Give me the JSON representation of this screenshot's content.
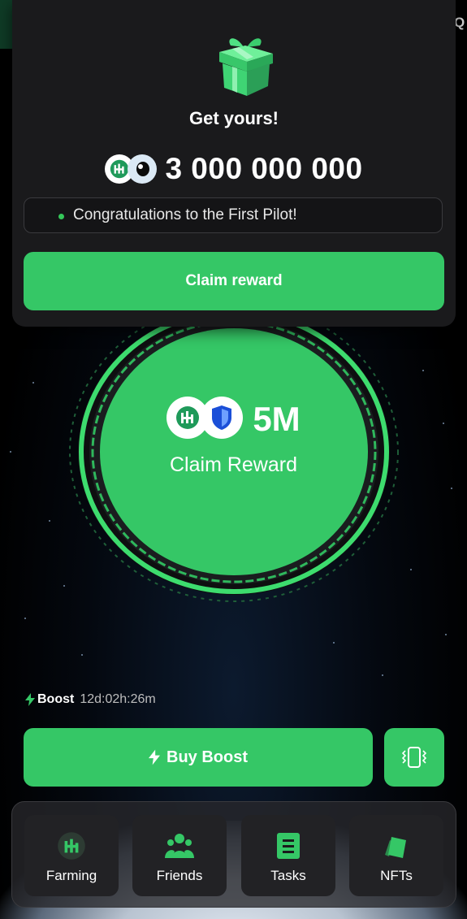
{
  "popup": {
    "title": "Get yours!",
    "amount": "3 000 000 000",
    "message": "Congratulations to the First Pilot!",
    "claim_label": "Claim reward"
  },
  "header_right_partial": "Q",
  "reward": {
    "amount": "5M",
    "label": "Claim Reward"
  },
  "boost": {
    "label": "Boost",
    "timer": "12d:02h:26m",
    "buy_label": "Buy Boost"
  },
  "nav": {
    "items": [
      {
        "label": "Farming",
        "icon": "farming-logo-icon"
      },
      {
        "label": "Friends",
        "icon": "friends-icon"
      },
      {
        "label": "Tasks",
        "icon": "tasks-icon"
      },
      {
        "label": "NFTs",
        "icon": "nft-cards-icon"
      }
    ]
  },
  "colors": {
    "accent": "#35c766",
    "card_bg": "#1a1a1c",
    "background": "#000000"
  }
}
